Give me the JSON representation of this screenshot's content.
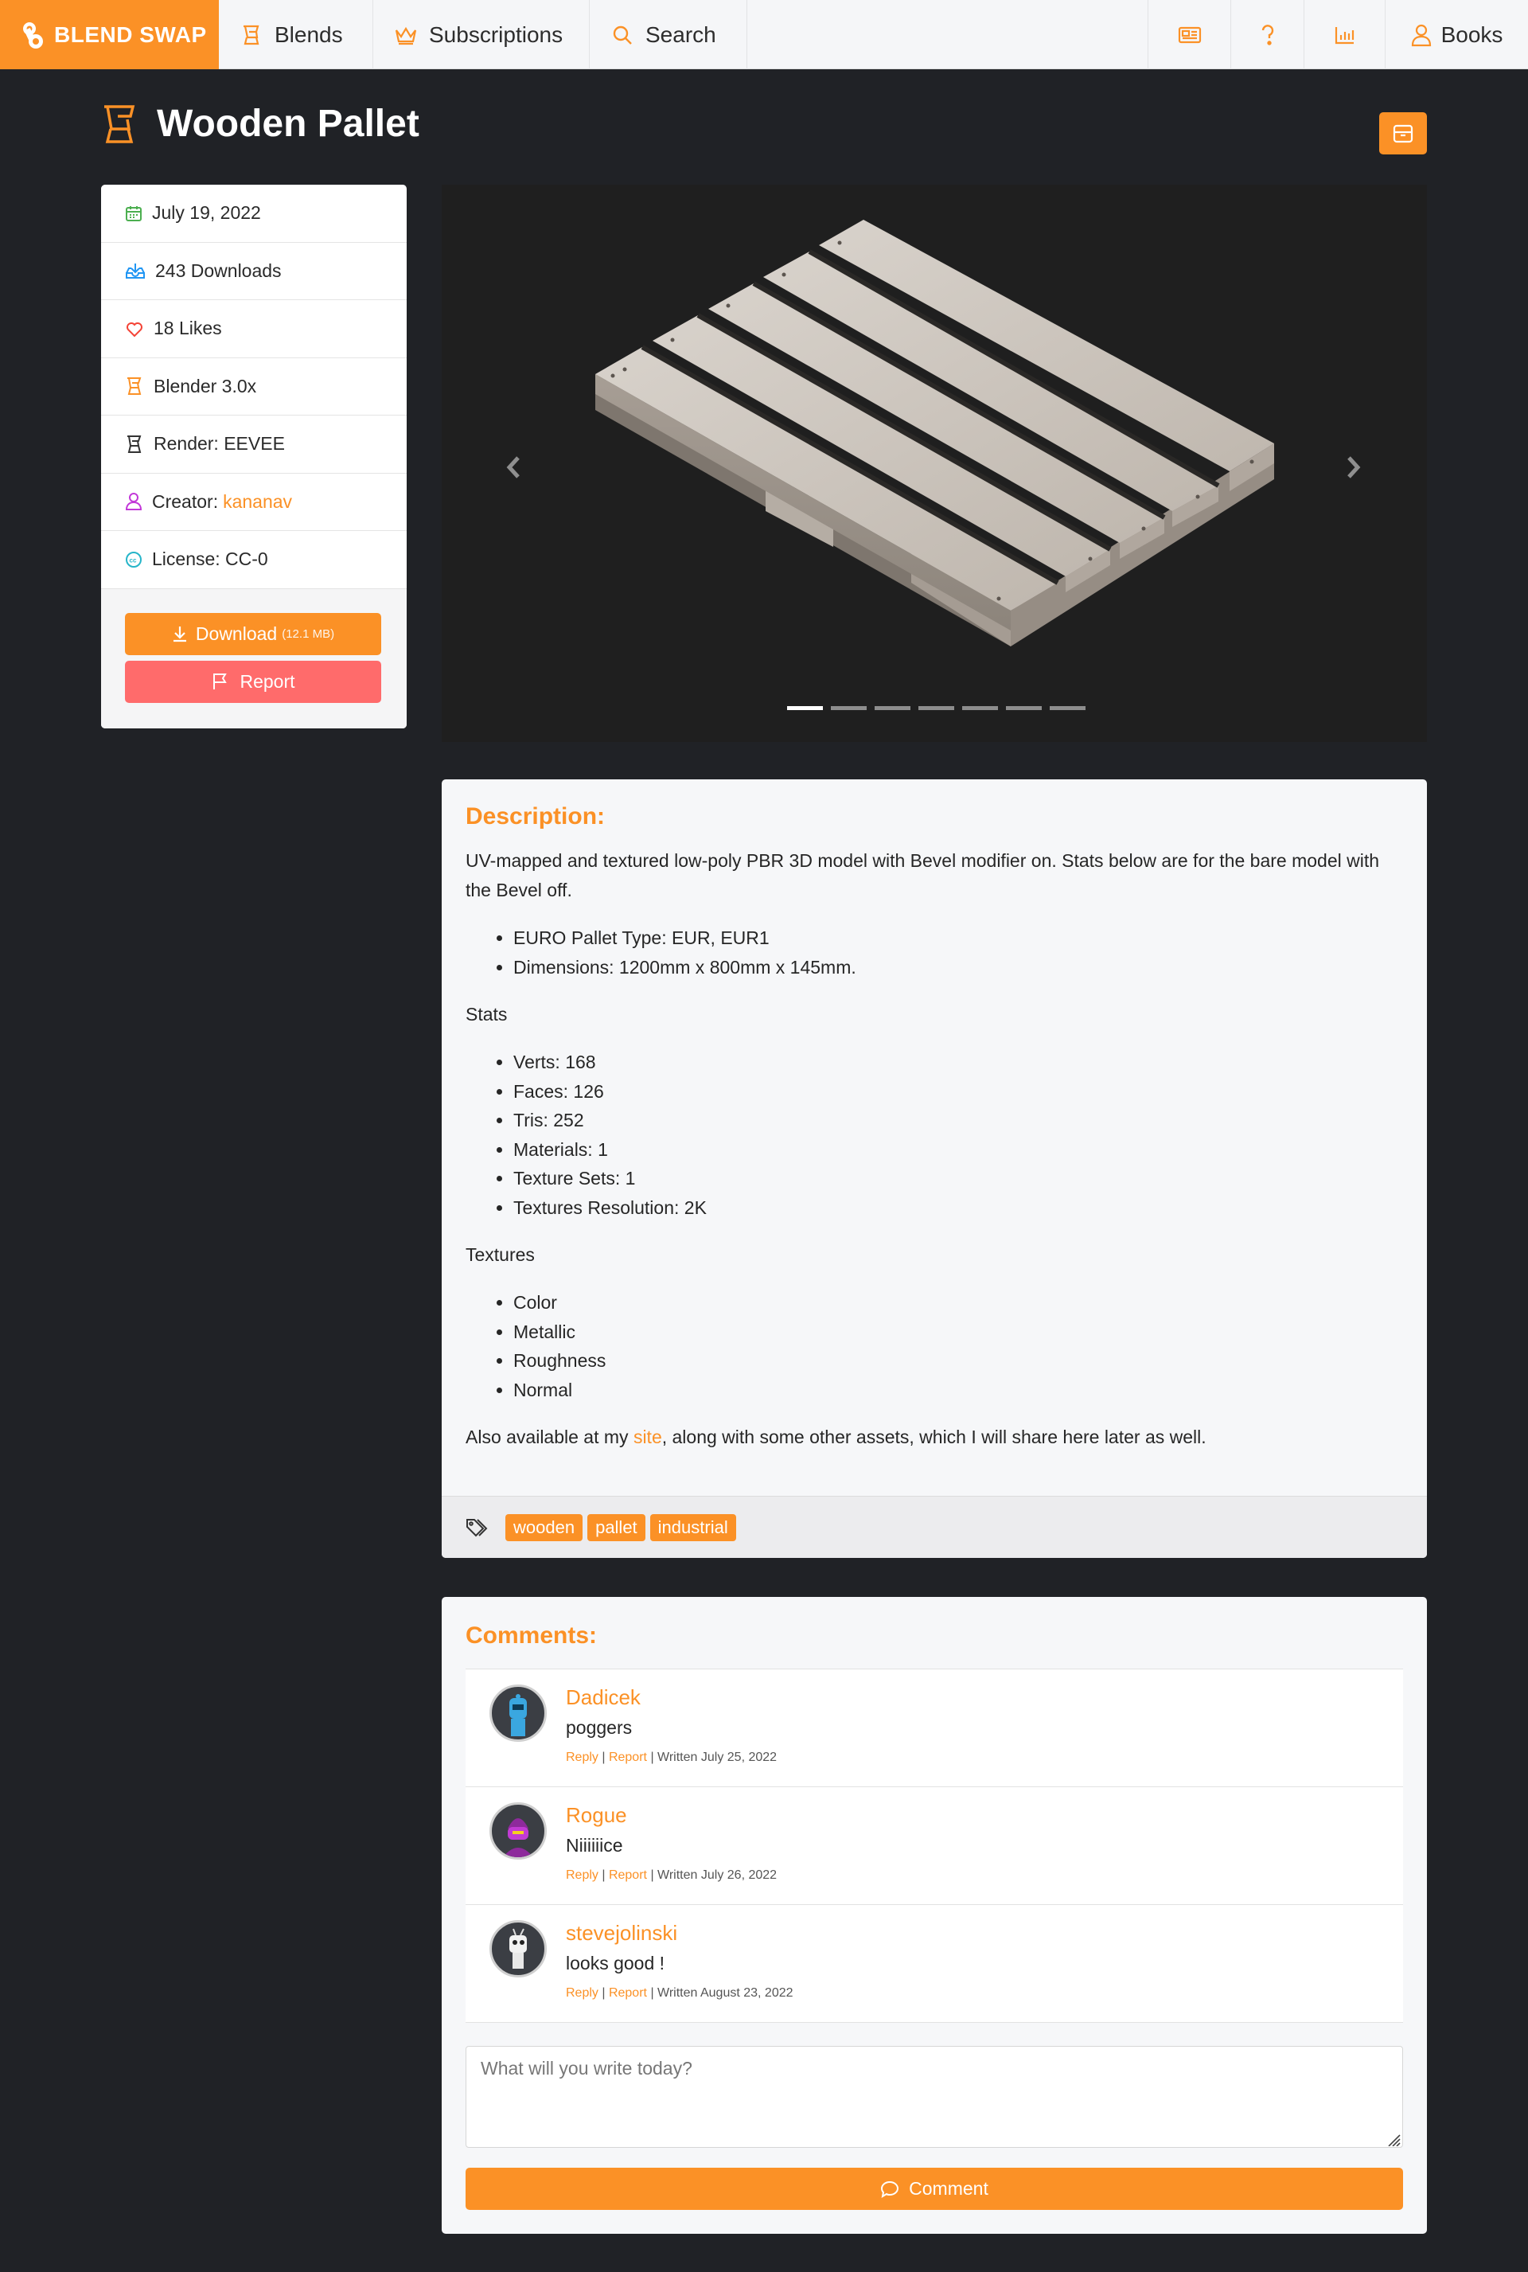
{
  "nav": {
    "logo_text": "BLEND SWAP",
    "items": [
      {
        "label": "Blends",
        "icon": "blender-icon"
      },
      {
        "label": "Subscriptions",
        "icon": "crown-icon"
      },
      {
        "label": "Search",
        "icon": "search-icon"
      }
    ],
    "right_icons": [
      "newspaper-icon",
      "question-icon",
      "chart-icon"
    ],
    "account_label": "Books",
    "accent_color": "#fb9126"
  },
  "page": {
    "title": "Wooden Pallet"
  },
  "info": {
    "date": "July 19, 2022",
    "downloads": "243 Downloads",
    "likes": "18 Likes",
    "blender": "Blender 3.0x",
    "render": "Render: EEVEE",
    "creator_label": "Creator:",
    "creator_name": "kananav",
    "license": "License: CC-0",
    "download_label": "Download",
    "download_size": "(12.1 MB)",
    "report_label": "Report"
  },
  "carousel": {
    "slide_count": 7,
    "active_index": 0
  },
  "description": {
    "heading": "Description:",
    "intro": "UV-mapped and textured low-poly PBR 3D model with Bevel modifier on. Stats below are for the bare model with the Bevel off.",
    "specs": [
      "EURO Pallet Type: EUR, EUR1",
      "Dimensions: 1200mm x 800mm x 145mm."
    ],
    "stats_heading": "Stats",
    "stats": [
      "Verts: 168",
      "Faces: 126",
      "Tris: 252",
      "Materials: 1",
      "Texture Sets: 1",
      "Textures Resolution: 2K"
    ],
    "textures_heading": "Textures",
    "textures": [
      "Color",
      "Metallic",
      "Roughness",
      "Normal"
    ],
    "outro_before": "Also available at my ",
    "outro_link": "site",
    "outro_after": ", along with some other assets, which I will share here later as well.",
    "tags": [
      "wooden",
      "pallet",
      "industrial"
    ]
  },
  "comments": {
    "heading": "Comments:",
    "list": [
      {
        "author": "Dadicek",
        "text": "poggers",
        "reply": "Reply",
        "report": "Report",
        "written": "| Written July 25, 2022"
      },
      {
        "author": "Rogue",
        "text": "Niiiiiice",
        "reply": "Reply",
        "report": "Report",
        "written": "| Written July 26, 2022"
      },
      {
        "author": "stevejolinski",
        "text": "looks good !",
        "reply": "Reply",
        "report": "Report",
        "written": "| Written August 23, 2022"
      }
    ],
    "input_placeholder": "What will you write today?",
    "submit_label": "Comment"
  }
}
